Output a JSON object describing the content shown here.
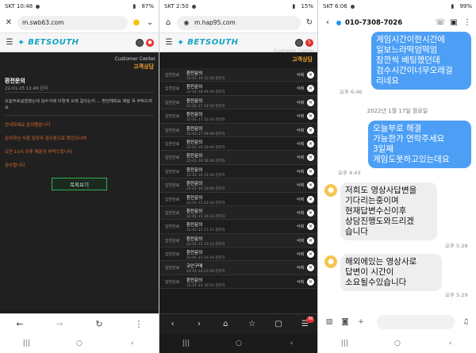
{
  "panel1": {
    "status": {
      "carrier_time": "SKT 10:48",
      "battery": "87%"
    },
    "url": "m.swb63.com",
    "logo_text": "BETSOUTH",
    "customer_center": "Customer Center",
    "section_title": "고객상담",
    "post_title": "환전문의",
    "post_date": "22-01-25 12:49 관리",
    "post_body": "오늘부로실점했는데 검수가왜 이렇게 오래 걸리는지 ... 환전해줘요 제발 꼭 부탁드려요",
    "notes": [
      "안내하세요 문의했습니다",
      "문의하신 사항 담당자 검수중으로 확인되시며",
      "오전 10시 이후 재문의 부탁드립니다",
      "감사합니다"
    ],
    "list_button": "목록보기"
  },
  "panel2": {
    "status": {
      "carrier_time": "SKT 2:50",
      "battery": "15%"
    },
    "url": "m.hap95.com",
    "logo_text": "BETSOUTH",
    "customer_center": "Customer Center",
    "section_title": "고객상담",
    "badge_count": "5",
    "bottom_badge": "36",
    "rows": [
      {
        "status": "답변완료",
        "title": "환전문의",
        "date": "22-01-19 12:56 관리자",
        "action": "삭제"
      },
      {
        "status": "답변완료",
        "title": "환전문의",
        "date": "22-01-18 09:39 관리자",
        "action": "삭제"
      },
      {
        "status": "답변완료",
        "title": "환전문의",
        "date": "22-01-17 14:50 관리자",
        "action": "삭제"
      },
      {
        "status": "답변완료",
        "title": "환전문의",
        "date": "22-01-17 12:19 관리자",
        "action": "삭제"
      },
      {
        "status": "답변완료",
        "title": "환전문의",
        "date": "22-01-17 09:08 관리자",
        "action": "삭제"
      },
      {
        "status": "답변완료",
        "title": "환전문의",
        "date": "22-01-16 20:46 관리자",
        "action": "삭제"
      },
      {
        "status": "답변완료",
        "title": "환전문의",
        "date": "22-01-16 16:38 관리자",
        "action": "삭제"
      },
      {
        "status": "답변완료",
        "title": "환전문의",
        "date": "22-01-16 13:39 관리자",
        "action": "삭제"
      },
      {
        "status": "답변완료",
        "title": "환전문의",
        "date": "22-01-16 10:06 관리자",
        "action": "삭제"
      },
      {
        "status": "답변완료",
        "title": "환전문의",
        "date": "22-01-15 22:54 관리자",
        "action": "삭제"
      },
      {
        "status": "답변완료",
        "title": "환전문의",
        "date": "22-01-15 19:22 관리자",
        "action": "삭제"
      },
      {
        "status": "답변완료",
        "title": "환전문의",
        "date": "22-01-15 17:11 관리자",
        "action": "삭제"
      },
      {
        "status": "답변완료",
        "title": "환전문의",
        "date": "22-01-15 13:13 관리자",
        "action": "삭제"
      },
      {
        "status": "답변완료",
        "title": "환전문의",
        "date": "22-01-15 10:19 관리자",
        "action": "삭제"
      },
      {
        "status": "답변완료",
        "title": "코인구매",
        "date": "22-01-14 21:00 관리자",
        "action": "삭제"
      },
      {
        "status": "답변완료",
        "title": "환전문의",
        "date": "22-01-14 16:52 관리자",
        "action": "삭제"
      }
    ]
  },
  "panel3": {
    "status": {
      "carrier_time": "SKT 6:06",
      "battery": "99%"
    },
    "phone_number": "010-7308-7026",
    "messages": [
      {
        "dir": "out",
        "text": "게임시간이한시간에\n일보느라떡엄떡엄\n잠깐씩 베팅했던데\n검수시간이너무오래걸\n리네요",
        "time": "오후 6:46"
      },
      {
        "dir": "sep",
        "text": "2022년 1월 17일 월요일"
      },
      {
        "dir": "out",
        "text": "오늘부로 해결\n가능한가 연락주세요\n3일째\n게임도못하고있는데요",
        "time": "오후 4:43"
      },
      {
        "dir": "in",
        "text": "저희도 영상사답변을\n기다리는중이며\n현재답변수신이후\n상담진행도와드리겠\n습니다",
        "time": "오후 5:28"
      },
      {
        "dir": "in",
        "text": "해외에있는 영상사로\n답변이 시간이\n소요될수있습니다",
        "time": "오후 5:29"
      }
    ]
  },
  "colors": {
    "accent_blue": "#4d9ff5",
    "logo": "#17a2c4",
    "note_orange": "#e0692b",
    "button_green": "#2fae4e"
  }
}
